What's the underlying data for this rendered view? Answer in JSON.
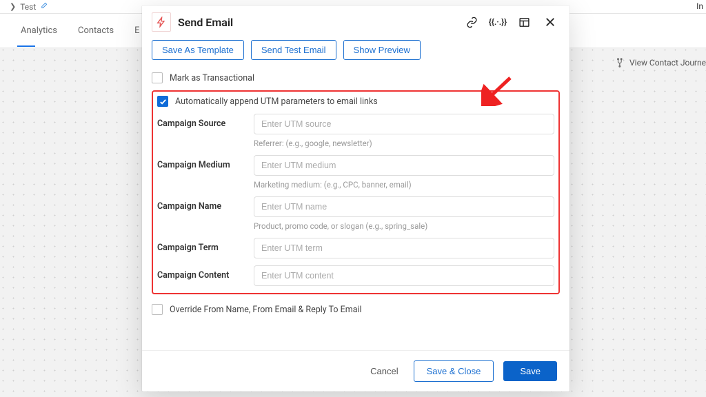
{
  "breadcrumb": {
    "label": "Test"
  },
  "bg_tabs": [
    "Analytics",
    "Contacts",
    "E"
  ],
  "bg_topright": "In",
  "bg_right_chip": "View Contact Journe",
  "modal": {
    "title": "Send Email",
    "buttons": {
      "save_template": "Save As Template",
      "send_test": "Send Test Email",
      "preview": "Show Preview"
    },
    "checkboxes": {
      "transactional": "Mark as Transactional",
      "utm": "Automatically append UTM parameters to email links",
      "override": "Override From Name, From Email & Reply To Email"
    },
    "fields": {
      "source": {
        "label": "Campaign Source",
        "placeholder": "Enter UTM source",
        "help": "Referrer: (e.g., google, newsletter)"
      },
      "medium": {
        "label": "Campaign Medium",
        "placeholder": "Enter UTM medium",
        "help": "Marketing medium: (e.g., CPC, banner, email)"
      },
      "name": {
        "label": "Campaign Name",
        "placeholder": "Enter UTM name",
        "help": "Product, promo code, or slogan (e.g., spring_sale)"
      },
      "term": {
        "label": "Campaign Term",
        "placeholder": "Enter UTM term"
      },
      "content": {
        "label": "Campaign Content",
        "placeholder": "Enter UTM content"
      }
    },
    "footer": {
      "cancel": "Cancel",
      "save_close": "Save & Close",
      "save": "Save"
    }
  }
}
